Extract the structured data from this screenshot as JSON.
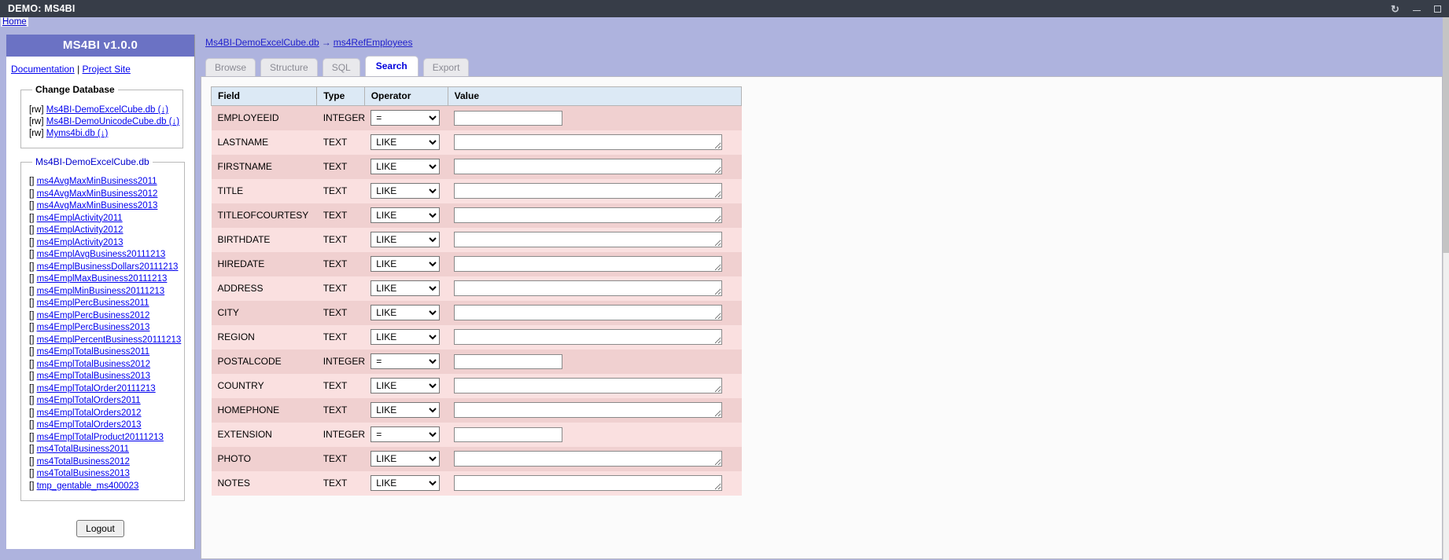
{
  "window": {
    "title": "DEMO: MS4BI",
    "buttons": [
      {
        "name": "refresh-icon",
        "glyph": "↻"
      },
      {
        "name": "minimize-icon",
        "glyph": "–"
      },
      {
        "name": "maximize-icon",
        "glyph": "□"
      }
    ]
  },
  "homebar": {
    "home_label": "Home"
  },
  "sidebar": {
    "app_title": "MS4BI v1.0.0",
    "links": {
      "documentation": "Documentation",
      "separator": "|",
      "project_site": "Project Site"
    },
    "change_database": {
      "legend": "Change Database",
      "items": [
        {
          "perm": "[rw]",
          "name": "Ms4BI-DemoExcelCube.db",
          "download": "(↓)"
        },
        {
          "perm": "[rw]",
          "name": "Ms4BI-DemoUnicodeCube.db",
          "download": "(↓)"
        },
        {
          "perm": "[rw]",
          "name": "Myms4bi.db",
          "download": "(↓)"
        }
      ]
    },
    "tables_box": {
      "legend": "Ms4BI-DemoExcelCube.db",
      "bracket": "[]",
      "items": [
        "ms4AvgMaxMinBusiness2011",
        "ms4AvgMaxMinBusiness2012",
        "ms4AvgMaxMinBusiness2013",
        "ms4EmplActivity2011",
        "ms4EmplActivity2012",
        "ms4EmplActivity2013",
        "ms4EmplAvgBusiness20111213",
        "ms4EmplBusinessDollars20111213",
        "ms4EmplMaxBusiness20111213",
        "ms4EmplMinBusiness20111213",
        "ms4EmplPercBusiness2011",
        "ms4EmplPercBusiness2012",
        "ms4EmplPercBusiness2013",
        "ms4EmplPercentBusiness20111213",
        "ms4EmplTotalBusiness2011",
        "ms4EmplTotalBusiness2012",
        "ms4EmplTotalBusiness2013",
        "ms4EmplTotalOrder20111213",
        "ms4EmplTotalOrders2011",
        "ms4EmplTotalOrders2012",
        "ms4EmplTotalOrders2013",
        "ms4EmplTotalProduct20111213",
        "ms4TotalBusiness2011",
        "ms4TotalBusiness2012",
        "ms4TotalBusiness2013",
        "tmp_gentable_ms400023"
      ]
    },
    "logout_label": "Logout"
  },
  "main": {
    "breadcrumb": {
      "db": "Ms4BI-DemoExcelCube.db",
      "arrow": "→",
      "table": "ms4RefEmployees"
    },
    "tabs": [
      {
        "label": "Browse",
        "active": false
      },
      {
        "label": "Structure",
        "active": false
      },
      {
        "label": "SQL",
        "active": false
      },
      {
        "label": "Search",
        "active": true
      },
      {
        "label": "Export",
        "active": false
      }
    ],
    "table_headers": [
      "Field",
      "Type",
      "Operator",
      "Value"
    ],
    "operator_options_text": [
      "=",
      "LIKE"
    ],
    "rows": [
      {
        "field": "EMPLOYEEID",
        "type": "INTEGER",
        "operator": "=",
        "value": "",
        "input": "text"
      },
      {
        "field": "LASTNAME",
        "type": "TEXT",
        "operator": "LIKE",
        "value": "",
        "input": "textarea"
      },
      {
        "field": "FIRSTNAME",
        "type": "TEXT",
        "operator": "LIKE",
        "value": "",
        "input": "textarea"
      },
      {
        "field": "TITLE",
        "type": "TEXT",
        "operator": "LIKE",
        "value": "",
        "input": "textarea"
      },
      {
        "field": "TITLEOFCOURTESY",
        "type": "TEXT",
        "operator": "LIKE",
        "value": "",
        "input": "textarea"
      },
      {
        "field": "BIRTHDATE",
        "type": "TEXT",
        "operator": "LIKE",
        "value": "",
        "input": "textarea"
      },
      {
        "field": "HIREDATE",
        "type": "TEXT",
        "operator": "LIKE",
        "value": "",
        "input": "textarea"
      },
      {
        "field": "ADDRESS",
        "type": "TEXT",
        "operator": "LIKE",
        "value": "",
        "input": "textarea"
      },
      {
        "field": "CITY",
        "type": "TEXT",
        "operator": "LIKE",
        "value": "",
        "input": "textarea"
      },
      {
        "field": "REGION",
        "type": "TEXT",
        "operator": "LIKE",
        "value": "",
        "input": "textarea"
      },
      {
        "field": "POSTALCODE",
        "type": "INTEGER",
        "operator": "=",
        "value": "",
        "input": "text"
      },
      {
        "field": "COUNTRY",
        "type": "TEXT",
        "operator": "LIKE",
        "value": "",
        "input": "textarea"
      },
      {
        "field": "HOMEPHONE",
        "type": "TEXT",
        "operator": "LIKE",
        "value": "",
        "input": "textarea"
      },
      {
        "field": "EXTENSION",
        "type": "INTEGER",
        "operator": "=",
        "value": "",
        "input": "text"
      },
      {
        "field": "PHOTO",
        "type": "TEXT",
        "operator": "LIKE",
        "value": "",
        "input": "textarea"
      },
      {
        "field": "NOTES",
        "type": "TEXT",
        "operator": "LIKE",
        "value": "",
        "input": "textarea"
      }
    ]
  },
  "colors": {
    "titlebar_bg": "#373d48",
    "page_bg": "#aeb3de",
    "sidebar_head_bg": "#6b72c4",
    "row_odd": "#f0d0d0",
    "row_even": "#fae0e0",
    "header_bg": "#dce9f5",
    "link": "#0000ee"
  }
}
